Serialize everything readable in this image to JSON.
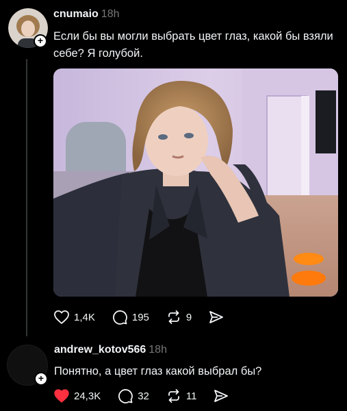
{
  "post": {
    "username": "cnumaio",
    "time": "18h",
    "text": "Если бы вы могли выбрать цвет глаз, какой бы взяли себе? Я голубой.",
    "likes": "1,4K",
    "replies": "195",
    "reposts": "9",
    "icons": {
      "like": "heart-outline-icon",
      "reply": "speech-bubble-icon",
      "repost": "repost-icon",
      "share": "send-icon",
      "follow": "plus-icon"
    }
  },
  "reply": {
    "username": "andrew_kotov566",
    "time": "18h",
    "text": "Понятно, а цвет глаз какой выбрал бы?",
    "likes": "24,3K",
    "replies": "32",
    "reposts": "11",
    "liked": true,
    "like_color": "#ff3040"
  }
}
